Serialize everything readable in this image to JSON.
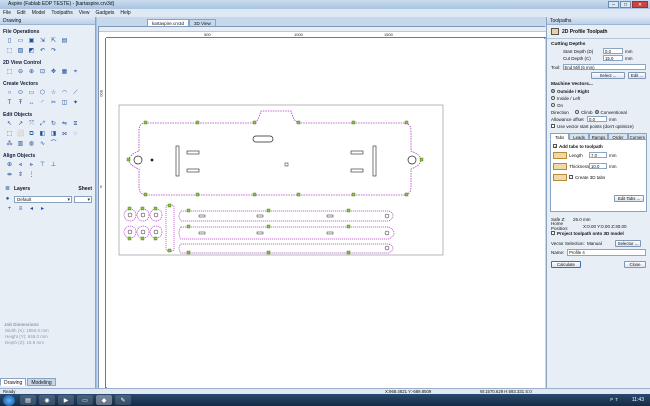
{
  "window": {
    "title": "Aspire (Fablab EDP TESTE) - [kartaspire.crv3d]",
    "controls": [
      "–",
      "□",
      "✕"
    ]
  },
  "menu": [
    "File",
    "Edit",
    "Model",
    "Toolpaths",
    "View",
    "Gadgets",
    "Help"
  ],
  "left": {
    "panel_title": "Drawing",
    "sections": {
      "file_ops": "File Operations",
      "view_ctrl": "2D View Control",
      "create_vec": "Create Vectors",
      "edit_obj": "Edit Objects",
      "align_obj": "Align Objects",
      "layers": "Layers",
      "sheet": "Sheet"
    },
    "layer_value": "Default",
    "job": {
      "title": "Job Dimensions",
      "width": "Width  (X): 1850.0 mm",
      "height": "Height (Y): 848.0 mm",
      "depth": "Depth  (Z): 15.8 mm"
    },
    "tabs": [
      "Drawing",
      "Modeling"
    ]
  },
  "doc": {
    "tabs": [
      "kartaspire.crv3d",
      "3D View"
    ],
    "ruler_h": [
      "500",
      "1000",
      "1500"
    ],
    "ruler_v": [
      "500",
      "0"
    ]
  },
  "right": {
    "panel_title": "Toolpaths",
    "title": "2D Profile Toolpath",
    "cutting_depths": "Cutting Depths",
    "start_depth_label": "Start Depth (D)",
    "start_depth": "0.0",
    "cut_depth_label": "Cut Depth (C)",
    "cut_depth": "15.0",
    "unit": "mm",
    "tool_label": "Tool:",
    "tool_value": "End Mill (6 mm)",
    "select": "Select ...",
    "edit": "Edit ...",
    "machine_vectors": "Machine Vectors...",
    "radio_outside": "Outside / Right",
    "radio_inside": "Inside / Left",
    "radio_on": "On",
    "direction_label": "Direction",
    "climb": "Climb",
    "conventional": "Conventional",
    "allowance_label": "Allowance offset",
    "allowance": "0.0",
    "start_points": "Use vector start points (don't optimize)",
    "tabs": [
      "Tabs",
      "Leads",
      "Ramps",
      "Order",
      "Corners"
    ],
    "add_tabs": "Add tabs to toolpath",
    "length_label": "Length",
    "length": "7.0",
    "thickness_label": "Thickness",
    "thickness": "10.0",
    "tabs3d": "Create 3D tabs",
    "edit_tabs": "Edit Tabs ...",
    "safe_z": "Safe Z:",
    "safe_z_val": "25.0 mm",
    "home_pos": "Home Position:",
    "home_val": "X:0.00 Y:0.00 Z:30.00",
    "project": "Project toolpath onto 3D model",
    "vector_sel_label": "Vector Selection:",
    "vector_sel": "Manual",
    "selector": "Selector ...",
    "name_label": "Name:",
    "name": "Profile 4",
    "calculate": "Calculate",
    "close": "Close"
  },
  "status": {
    "ready": "Ready",
    "coords": "X:968.4821 Y:-689.8509",
    "dims": "W:1570.629  H:693.331  S:0"
  },
  "taskbar": {
    "clock": "11:43",
    "lang": "PT"
  }
}
